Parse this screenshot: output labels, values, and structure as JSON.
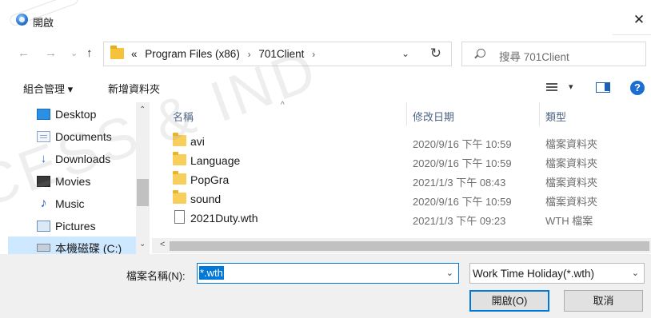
{
  "window": {
    "title": "開啟",
    "close": "✕"
  },
  "nav": {
    "back": "←",
    "forward": "→",
    "recent": "⌄",
    "up": "↑"
  },
  "address": {
    "overflow": "«",
    "crumbs": [
      "Program Files (x86)",
      "701Client"
    ],
    "separator": "›",
    "dropdown": "⌄",
    "refresh": "↻"
  },
  "search": {
    "placeholder": "搜尋 701Client"
  },
  "toolbar": {
    "organize": "組合管理 ▾",
    "new_folder": "新增資料夾",
    "view_drop": "▾",
    "help": "?"
  },
  "sidebar": {
    "items": [
      {
        "label": "Desktop",
        "icon": "desktop-icon"
      },
      {
        "label": "Documents",
        "icon": "documents-icon"
      },
      {
        "label": "Downloads",
        "icon": "downloads-icon"
      },
      {
        "label": "Movies",
        "icon": "movies-icon"
      },
      {
        "label": "Music",
        "icon": "music-icon"
      },
      {
        "label": "Pictures",
        "icon": "pictures-icon"
      },
      {
        "label": "本機磁碟 (C:)",
        "icon": "drive-icon"
      }
    ],
    "scroll_up": "⌃",
    "scroll_down": "⌄"
  },
  "columns": {
    "name": "名稱",
    "date": "修改日期",
    "type": "類型",
    "sort_caret": "^"
  },
  "files": [
    {
      "name": "avi",
      "date": "2020/9/16 下午 10:59",
      "type": "檔案資料夾",
      "kind": "folder"
    },
    {
      "name": "Language",
      "date": "2020/9/16 下午 10:59",
      "type": "檔案資料夾",
      "kind": "folder"
    },
    {
      "name": "PopGra",
      "date": "2021/1/3 下午 08:43",
      "type": "檔案資料夾",
      "kind": "folder"
    },
    {
      "name": "sound",
      "date": "2020/9/16 下午 10:59",
      "type": "檔案資料夾",
      "kind": "folder"
    },
    {
      "name": "2021Duty.wth",
      "date": "2021/1/3 下午 09:23",
      "type": "WTH 檔案",
      "kind": "file"
    }
  ],
  "hscroll": {
    "left": "<"
  },
  "footer": {
    "filename_label": "檔案名稱(N):",
    "filename_value": "*.wth",
    "filename_drop": "⌄",
    "filetype": "Work Time Holiday(*.wth)",
    "filetype_drop": "⌄",
    "open_button": "開啟(O)",
    "cancel_button": "取消"
  },
  "watermark": "CESS & IND",
  "colors": {
    "accent": "#0078d7",
    "selection": "#cde8ff",
    "folder": "#f8cf5a"
  }
}
